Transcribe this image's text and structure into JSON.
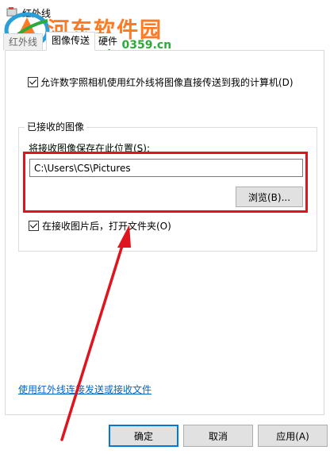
{
  "window": {
    "title": "红外线",
    "title_icon": "infrared-app-icon"
  },
  "watermark": {
    "line1": "河东软件园",
    "line2": "www.pc0359.cn",
    "color_orange": "#ff7a22",
    "color_green": "#2eaa3c"
  },
  "tabs": [
    {
      "label": "红外线",
      "active": false
    },
    {
      "label": "图像传送",
      "active": true
    },
    {
      "label": "硬件",
      "active": false
    }
  ],
  "options": {
    "allow_label": "允许数字照相机使用红外线将图像直接传送到我的计算机(D)",
    "allow_checked": true
  },
  "received_group": {
    "title": "已接收的图像",
    "save_location_label": "将接收图像保存在此位置(S):",
    "path_value": "C:\\Users\\CS\\Pictures",
    "browse_label": "浏览(B)...",
    "open_folder_label": "在接收图片后，打开文件夹(O)",
    "open_folder_checked": true
  },
  "link": {
    "send_receive_label": "使用红外线连接发送或接收文件"
  },
  "buttons": {
    "ok": "确定",
    "cancel": "取消",
    "apply": "应用(A)"
  },
  "annotation": {
    "highlight_color": "#e0141e"
  }
}
